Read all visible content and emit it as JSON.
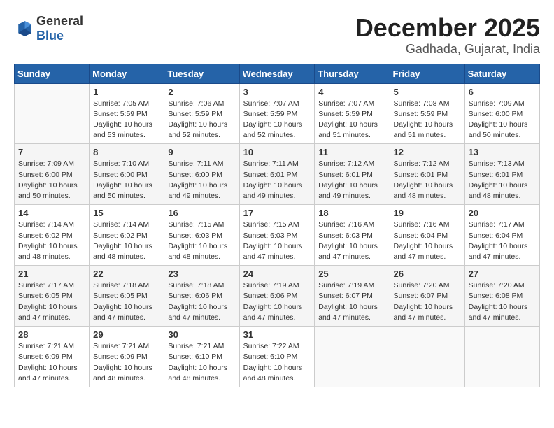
{
  "logo": {
    "text_general": "General",
    "text_blue": "Blue"
  },
  "header": {
    "month_year": "December 2025",
    "location": "Gadhada, Gujarat, India"
  },
  "weekdays": [
    "Sunday",
    "Monday",
    "Tuesday",
    "Wednesday",
    "Thursday",
    "Friday",
    "Saturday"
  ],
  "weeks": [
    [
      {
        "day": "",
        "info": ""
      },
      {
        "day": "1",
        "info": "Sunrise: 7:05 AM\nSunset: 5:59 PM\nDaylight: 10 hours\nand 53 minutes."
      },
      {
        "day": "2",
        "info": "Sunrise: 7:06 AM\nSunset: 5:59 PM\nDaylight: 10 hours\nand 52 minutes."
      },
      {
        "day": "3",
        "info": "Sunrise: 7:07 AM\nSunset: 5:59 PM\nDaylight: 10 hours\nand 52 minutes."
      },
      {
        "day": "4",
        "info": "Sunrise: 7:07 AM\nSunset: 5:59 PM\nDaylight: 10 hours\nand 51 minutes."
      },
      {
        "day": "5",
        "info": "Sunrise: 7:08 AM\nSunset: 5:59 PM\nDaylight: 10 hours\nand 51 minutes."
      },
      {
        "day": "6",
        "info": "Sunrise: 7:09 AM\nSunset: 6:00 PM\nDaylight: 10 hours\nand 50 minutes."
      }
    ],
    [
      {
        "day": "7",
        "info": "Sunrise: 7:09 AM\nSunset: 6:00 PM\nDaylight: 10 hours\nand 50 minutes."
      },
      {
        "day": "8",
        "info": "Sunrise: 7:10 AM\nSunset: 6:00 PM\nDaylight: 10 hours\nand 50 minutes."
      },
      {
        "day": "9",
        "info": "Sunrise: 7:11 AM\nSunset: 6:00 PM\nDaylight: 10 hours\nand 49 minutes."
      },
      {
        "day": "10",
        "info": "Sunrise: 7:11 AM\nSunset: 6:01 PM\nDaylight: 10 hours\nand 49 minutes."
      },
      {
        "day": "11",
        "info": "Sunrise: 7:12 AM\nSunset: 6:01 PM\nDaylight: 10 hours\nand 49 minutes."
      },
      {
        "day": "12",
        "info": "Sunrise: 7:12 AM\nSunset: 6:01 PM\nDaylight: 10 hours\nand 48 minutes."
      },
      {
        "day": "13",
        "info": "Sunrise: 7:13 AM\nSunset: 6:01 PM\nDaylight: 10 hours\nand 48 minutes."
      }
    ],
    [
      {
        "day": "14",
        "info": "Sunrise: 7:14 AM\nSunset: 6:02 PM\nDaylight: 10 hours\nand 48 minutes."
      },
      {
        "day": "15",
        "info": "Sunrise: 7:14 AM\nSunset: 6:02 PM\nDaylight: 10 hours\nand 48 minutes."
      },
      {
        "day": "16",
        "info": "Sunrise: 7:15 AM\nSunset: 6:03 PM\nDaylight: 10 hours\nand 48 minutes."
      },
      {
        "day": "17",
        "info": "Sunrise: 7:15 AM\nSunset: 6:03 PM\nDaylight: 10 hours\nand 47 minutes."
      },
      {
        "day": "18",
        "info": "Sunrise: 7:16 AM\nSunset: 6:03 PM\nDaylight: 10 hours\nand 47 minutes."
      },
      {
        "day": "19",
        "info": "Sunrise: 7:16 AM\nSunset: 6:04 PM\nDaylight: 10 hours\nand 47 minutes."
      },
      {
        "day": "20",
        "info": "Sunrise: 7:17 AM\nSunset: 6:04 PM\nDaylight: 10 hours\nand 47 minutes."
      }
    ],
    [
      {
        "day": "21",
        "info": "Sunrise: 7:17 AM\nSunset: 6:05 PM\nDaylight: 10 hours\nand 47 minutes."
      },
      {
        "day": "22",
        "info": "Sunrise: 7:18 AM\nSunset: 6:05 PM\nDaylight: 10 hours\nand 47 minutes."
      },
      {
        "day": "23",
        "info": "Sunrise: 7:18 AM\nSunset: 6:06 PM\nDaylight: 10 hours\nand 47 minutes."
      },
      {
        "day": "24",
        "info": "Sunrise: 7:19 AM\nSunset: 6:06 PM\nDaylight: 10 hours\nand 47 minutes."
      },
      {
        "day": "25",
        "info": "Sunrise: 7:19 AM\nSunset: 6:07 PM\nDaylight: 10 hours\nand 47 minutes."
      },
      {
        "day": "26",
        "info": "Sunrise: 7:20 AM\nSunset: 6:07 PM\nDaylight: 10 hours\nand 47 minutes."
      },
      {
        "day": "27",
        "info": "Sunrise: 7:20 AM\nSunset: 6:08 PM\nDaylight: 10 hours\nand 47 minutes."
      }
    ],
    [
      {
        "day": "28",
        "info": "Sunrise: 7:21 AM\nSunset: 6:09 PM\nDaylight: 10 hours\nand 47 minutes."
      },
      {
        "day": "29",
        "info": "Sunrise: 7:21 AM\nSunset: 6:09 PM\nDaylight: 10 hours\nand 48 minutes."
      },
      {
        "day": "30",
        "info": "Sunrise: 7:21 AM\nSunset: 6:10 PM\nDaylight: 10 hours\nand 48 minutes."
      },
      {
        "day": "31",
        "info": "Sunrise: 7:22 AM\nSunset: 6:10 PM\nDaylight: 10 hours\nand 48 minutes."
      },
      {
        "day": "",
        "info": ""
      },
      {
        "day": "",
        "info": ""
      },
      {
        "day": "",
        "info": ""
      }
    ]
  ]
}
